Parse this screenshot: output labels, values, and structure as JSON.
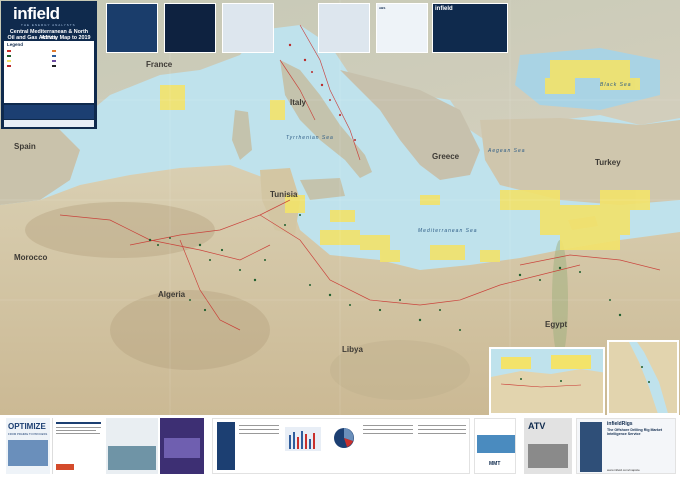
{
  "map": {
    "countries": [
      {
        "id": "france",
        "name": "France"
      },
      {
        "id": "spain",
        "name": "Spain"
      },
      {
        "id": "italy",
        "name": "Italy"
      },
      {
        "id": "greece",
        "name": "Greece"
      },
      {
        "id": "turkey",
        "name": "Turkey"
      },
      {
        "id": "morocco",
        "name": "Morocco"
      },
      {
        "id": "algeria",
        "name": "Algeria"
      },
      {
        "id": "tunisia",
        "name": "Tunisia"
      },
      {
        "id": "libya",
        "name": "Libya"
      },
      {
        "id": "egypt",
        "name": "Egypt"
      }
    ],
    "seas": [
      {
        "id": "mediterranean",
        "name": "Mediterranean Sea"
      },
      {
        "id": "black",
        "name": "Black Sea"
      },
      {
        "id": "tyrrhenian",
        "name": "Tyrrhenian Sea"
      },
      {
        "id": "aegean",
        "name": "Aegean Sea"
      }
    ],
    "colors": {
      "sea": "#bfe2ec",
      "land": "#d8d1bd",
      "desert": "#e2d4ae",
      "license_block": "#f3e36a",
      "pipeline": "#c9302c",
      "field": "#1f5e2d"
    }
  },
  "title_panel": {
    "logo": "infield",
    "logo_sub": "THE ENERGY ANALYSTS",
    "title_line1": "Central Mediterranean & North Africa",
    "title_line2": "Oil and Gas Activity Map to 2019",
    "legend_title": "Legend"
  },
  "top_ads": [
    {
      "text": ""
    },
    {
      "text": ""
    },
    {
      "text": ""
    },
    {
      "text": ""
    },
    {
      "text": "ABS"
    },
    {
      "text": "infield"
    }
  ],
  "footer": {
    "optimize_title": "OPTIMIZE",
    "optimize_sub": "FROM PRAIRIE TO PROCESS",
    "atv_label": "ATV",
    "mmt_label": "MMT",
    "drilling_title": "The Offshore Drilling Rig Market Intelligence Service",
    "drilling_logo": "infieldRigs",
    "website": "www.infield.com/mapsite"
  },
  "icons": [
    "compass-icon",
    "scale-bar-icon"
  ]
}
